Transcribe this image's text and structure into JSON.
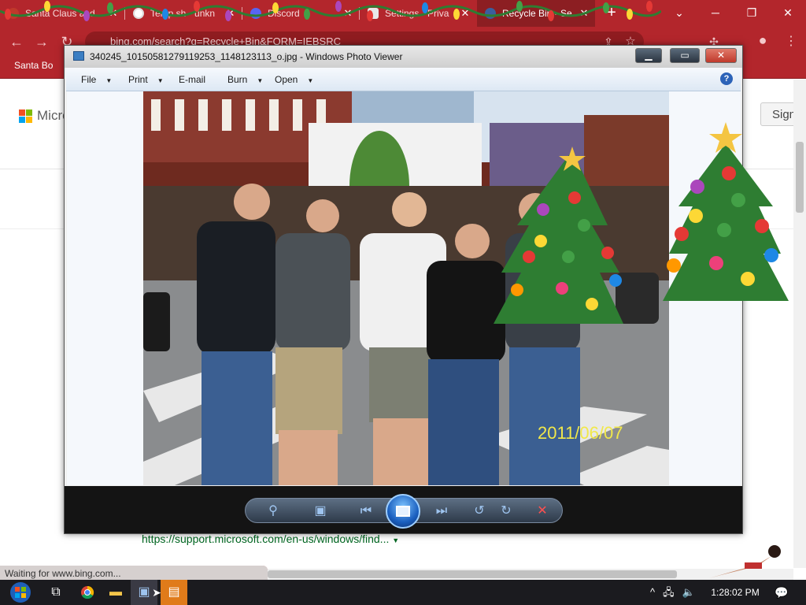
{
  "browser": {
    "tabs": [
      {
        "label": "Santa Claus and ",
        "favicon_color": "#c0392b",
        "active": false
      },
      {
        "label": "Temp.sh - unkn",
        "favicon_color": "#ffffff",
        "active": false
      },
      {
        "label": "Discord",
        "favicon_color": "#5865f2",
        "active": false
      },
      {
        "label": "Settings - Priva",
        "favicon_color": "#e8e8e8",
        "active": false
      },
      {
        "label": "Recycle Bin - Se",
        "favicon_color": "#3a5f9e",
        "active": true
      }
    ],
    "new_tab": "+",
    "url": "bing.com/search?q=Recycle+Bin&FORM=IEBSRC",
    "bookmark": "Santa Bo",
    "window_controls": {
      "minimize": "─",
      "restore": "❐",
      "close": "✕",
      "dropdown": "⌄"
    }
  },
  "page": {
    "logo_text": "Micro",
    "signin": "Sign",
    "result_link": "https://support.microsoft.com/en-us/windows/find...",
    "status": "Waiting for www.bing.com..."
  },
  "viewer": {
    "title": "340245_10150581279119253_1148123113_o.jpg - Windows Photo Viewer",
    "menu": [
      {
        "label": "File",
        "dropdown": true
      },
      {
        "label": "Print",
        "dropdown": true
      },
      {
        "label": "E-mail",
        "dropdown": false
      },
      {
        "label": "Burn",
        "dropdown": true
      },
      {
        "label": "Open",
        "dropdown": true
      }
    ],
    "help": "?",
    "photo_date": "2011/06/07",
    "controls": {
      "zoom": "⚲",
      "actual_size": "▣",
      "previous": "⏮",
      "next": "⏭",
      "rotate_ccw": "↺",
      "rotate_cw": "↻",
      "delete": "✕"
    }
  },
  "taskbar": {
    "clock": "1:28:02 PM",
    "tray": {
      "chevron": "^",
      "network": "🖧",
      "volume": "🔈"
    },
    "notification": "💬"
  },
  "colors": {
    "accent": "#b3262c",
    "link": "#006621"
  }
}
